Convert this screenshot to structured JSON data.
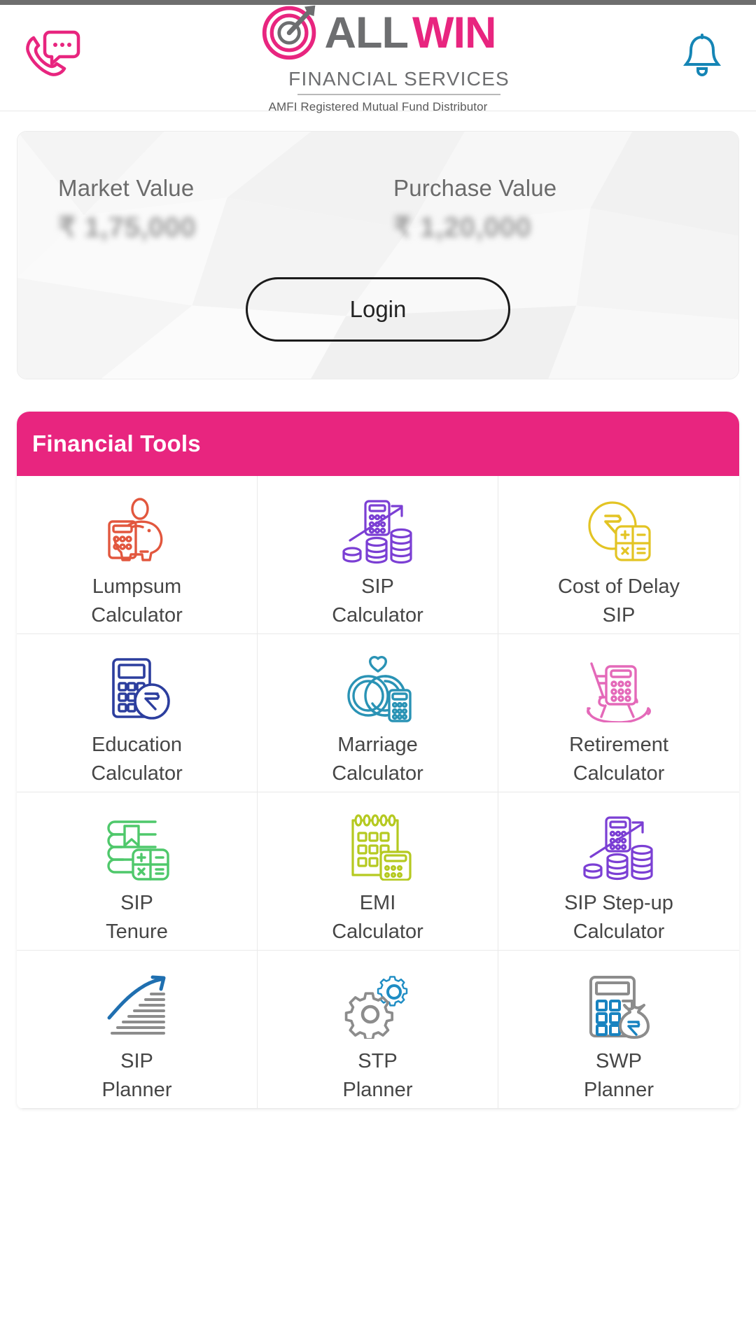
{
  "header": {
    "support_icon": "phone-chat-icon",
    "notification_icon": "bell-icon",
    "logo": {
      "word_primary": "ALL",
      "word_secondary": "WIN",
      "subtitle": "FINANCIAL SERVICES",
      "tagline": "AMFI Registered Mutual Fund Distributor",
      "mark": "target-dart-icon"
    }
  },
  "portfolio": {
    "market": {
      "label": "Market Value",
      "amount": "₹ 1,75,000"
    },
    "purchase": {
      "label": "Purchase Value",
      "amount": "₹ 1,20,000"
    },
    "login_label": "Login"
  },
  "tools": {
    "title": "Financial Tools",
    "accent_color": "#e8257f",
    "items": [
      {
        "icon": "piggy-bank-calculator-icon",
        "color": "#e2573e",
        "line1": "Lumpsum",
        "line2": "Calculator"
      },
      {
        "icon": "sip-coins-growth-icon",
        "color": "#7b3fd4",
        "line1": "SIP",
        "line2": "Calculator"
      },
      {
        "icon": "rupee-coin-calculator-icon",
        "color": "#e3c424",
        "line1": "Cost of Delay",
        "line2": "SIP"
      },
      {
        "icon": "education-calculator-icon",
        "color": "#2c3e9e",
        "line1": "Education",
        "line2": "Calculator"
      },
      {
        "icon": "marriage-rings-icon",
        "color": "#2a93b5",
        "line1": "Marriage",
        "line2": "Calculator"
      },
      {
        "icon": "rocking-chair-icon",
        "color": "#e469b9",
        "line1": "Retirement",
        "line2": "Calculator"
      },
      {
        "icon": "book-bookmark-calc-icon",
        "color": "#4fc86b",
        "line1": "SIP",
        "line2": "Tenure"
      },
      {
        "icon": "calendar-calculator-icon",
        "color": "#b5c920",
        "line1": "EMI",
        "line2": "Calculator"
      },
      {
        "icon": "stepup-coins-icon",
        "color": "#7b3fd4",
        "line1": "SIP Step-up",
        "line2": "Calculator"
      },
      {
        "icon": "growth-bars-arrow-icon",
        "color": "#1f6fb0",
        "line1": "SIP",
        "line2": "Planner"
      },
      {
        "icon": "gears-icon",
        "color": "#1f8dc4",
        "line1": "STP",
        "line2": "Planner"
      },
      {
        "icon": "calculator-moneybag-icon",
        "color": "#1883c0",
        "line1": "SWP",
        "line2": "Planner"
      }
    ]
  }
}
